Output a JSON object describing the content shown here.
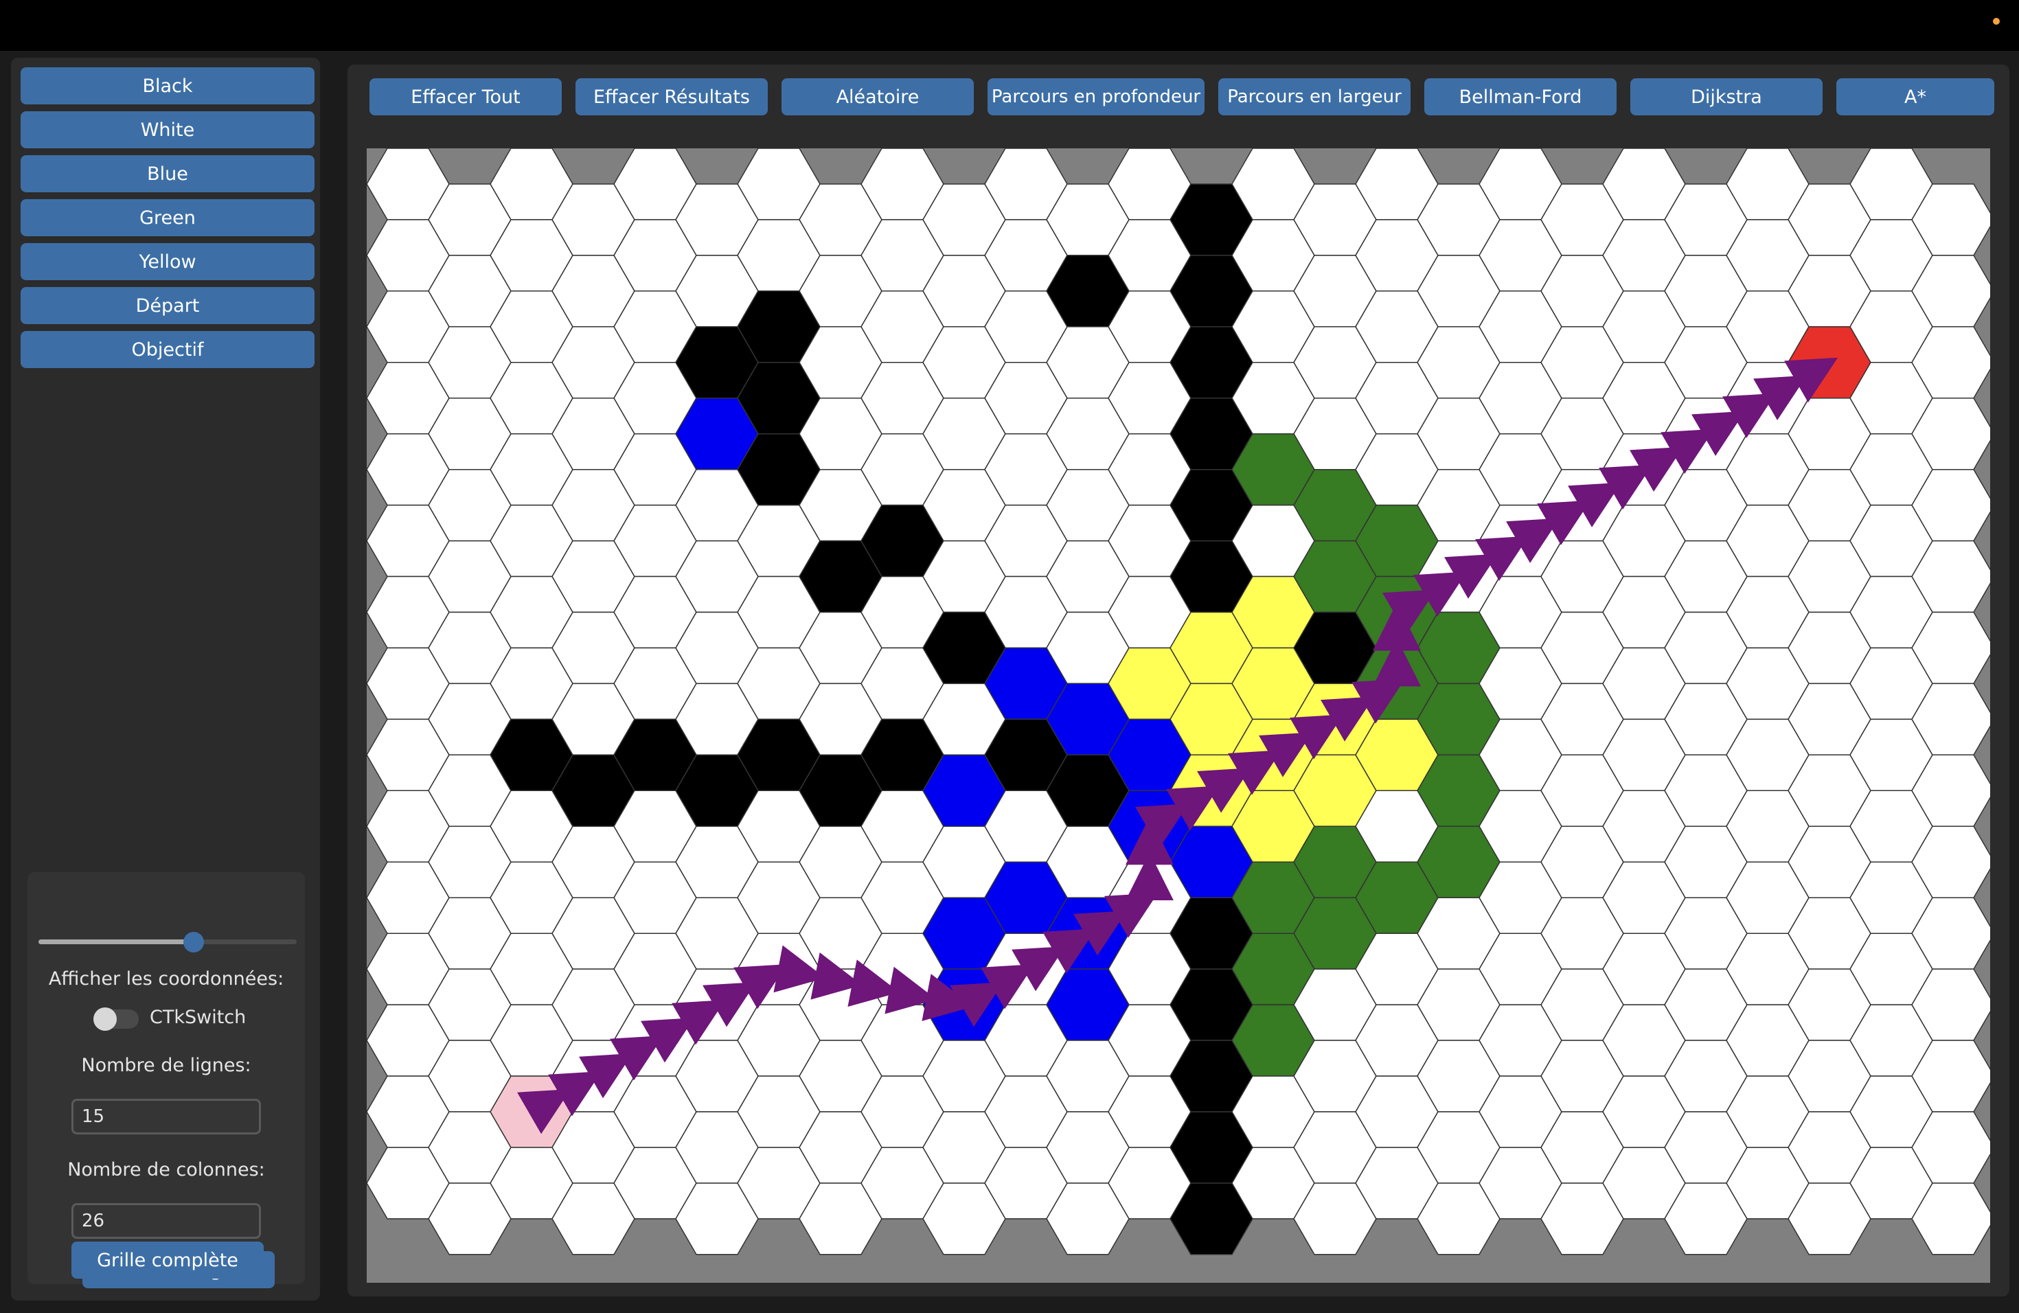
{
  "color_buttons": [
    {
      "label": "Black"
    },
    {
      "label": "White"
    },
    {
      "label": "Blue"
    },
    {
      "label": "Green"
    },
    {
      "label": "Yellow"
    },
    {
      "label": "Départ"
    },
    {
      "label": "Objectif"
    }
  ],
  "actions": [
    {
      "label": "Effacer Tout"
    },
    {
      "label": "Effacer Résultats"
    },
    {
      "label": "Aléatoire"
    },
    {
      "label": "Parcours en profondeur"
    },
    {
      "label": "Parcours en largeur"
    },
    {
      "label": "Bellman-Ford"
    },
    {
      "label": "Dijkstra"
    },
    {
      "label": "A*"
    }
  ],
  "settings": {
    "slider_value": 0.6,
    "show_coords_label": "Afficher les coordonnées:",
    "switch_label": "CTkSwitch",
    "switch_on": false,
    "rows_label": "Nombre de lignes:",
    "rows_value": "15",
    "cols_label": "Nombre de colonnes:",
    "cols_value": "26",
    "draw_button": "Dessiner la grille",
    "full_button": "Grille complète"
  },
  "grid": {
    "rows": 15,
    "cols": 26,
    "colors": {
      "white": "#ffffff",
      "black": "#000000",
      "blue": "#0000f0",
      "green": "#377b23",
      "yellow": "#ffff55",
      "start": "#f6c6d0",
      "goal": "#e8302a",
      "path": "#6e1679",
      "background": "#808080",
      "border": "#333333"
    },
    "start": [
      13,
      2
    ],
    "goal": [
      2,
      23
    ],
    "black": [
      [
        0,
        13
      ],
      [
        1,
        13
      ],
      [
        2,
        13
      ],
      [
        3,
        13
      ],
      [
        4,
        13
      ],
      [
        5,
        13
      ],
      [
        6,
        13
      ],
      [
        7,
        13
      ],
      [
        8,
        13
      ],
      [
        9,
        13
      ],
      [
        10,
        13
      ],
      [
        11,
        13
      ],
      [
        12,
        13
      ],
      [
        13,
        13
      ],
      [
        14,
        13
      ],
      [
        2,
        5
      ],
      [
        2,
        6
      ],
      [
        3,
        5
      ],
      [
        3,
        6
      ],
      [
        4,
        6
      ],
      [
        5,
        7
      ],
      [
        5,
        8
      ],
      [
        6,
        9
      ],
      [
        8,
        2
      ],
      [
        8,
        3
      ],
      [
        8,
        4
      ],
      [
        8,
        5
      ],
      [
        8,
        6
      ],
      [
        8,
        7
      ],
      [
        8,
        8
      ],
      [
        8,
        9
      ],
      [
        8,
        10
      ],
      [
        8,
        11
      ],
      [
        8,
        12
      ],
      [
        9,
        14
      ],
      [
        6,
        14
      ],
      [
        7,
        16
      ],
      [
        8,
        16
      ],
      [
        6,
        15
      ],
      [
        1,
        11
      ]
    ],
    "blue": [
      [
        3,
        5
      ],
      [
        8,
        9
      ],
      [
        7,
        10
      ],
      [
        7,
        11
      ],
      [
        8,
        12
      ],
      [
        9,
        12
      ],
      [
        9,
        13
      ],
      [
        10,
        9
      ],
      [
        10,
        10
      ],
      [
        10,
        11
      ],
      [
        11,
        9
      ],
      [
        11,
        11
      ]
    ],
    "green": [
      [
        4,
        14
      ],
      [
        4,
        15
      ],
      [
        5,
        15
      ],
      [
        5,
        16
      ],
      [
        6,
        16
      ],
      [
        7,
        17
      ],
      [
        8,
        17
      ],
      [
        9,
        17
      ],
      [
        9,
        15
      ],
      [
        10,
        14
      ],
      [
        10,
        15
      ],
      [
        11,
        14
      ],
      [
        12,
        14
      ],
      [
        6,
        17
      ],
      [
        10,
        16
      ],
      [
        7,
        16
      ]
    ],
    "yellow": [
      [
        7,
        11
      ],
      [
        7,
        12
      ],
      [
        7,
        13
      ],
      [
        7,
        14
      ],
      [
        7,
        15
      ],
      [
        8,
        13
      ],
      [
        8,
        14
      ],
      [
        8,
        15
      ],
      [
        8,
        16
      ],
      [
        9,
        13
      ],
      [
        9,
        14
      ],
      [
        6,
        13
      ],
      [
        6,
        14
      ]
    ],
    "path": [
      [
        13,
        2
      ],
      [
        12,
        3
      ],
      [
        11,
        6
      ],
      [
        11,
        9
      ],
      [
        11,
        10
      ],
      [
        10,
        12
      ],
      [
        9,
        12
      ],
      [
        8,
        14
      ],
      [
        7,
        16
      ],
      [
        6,
        16
      ],
      [
        5,
        17
      ],
      [
        4,
        19
      ],
      [
        3,
        21
      ],
      [
        2,
        23
      ]
    ]
  }
}
